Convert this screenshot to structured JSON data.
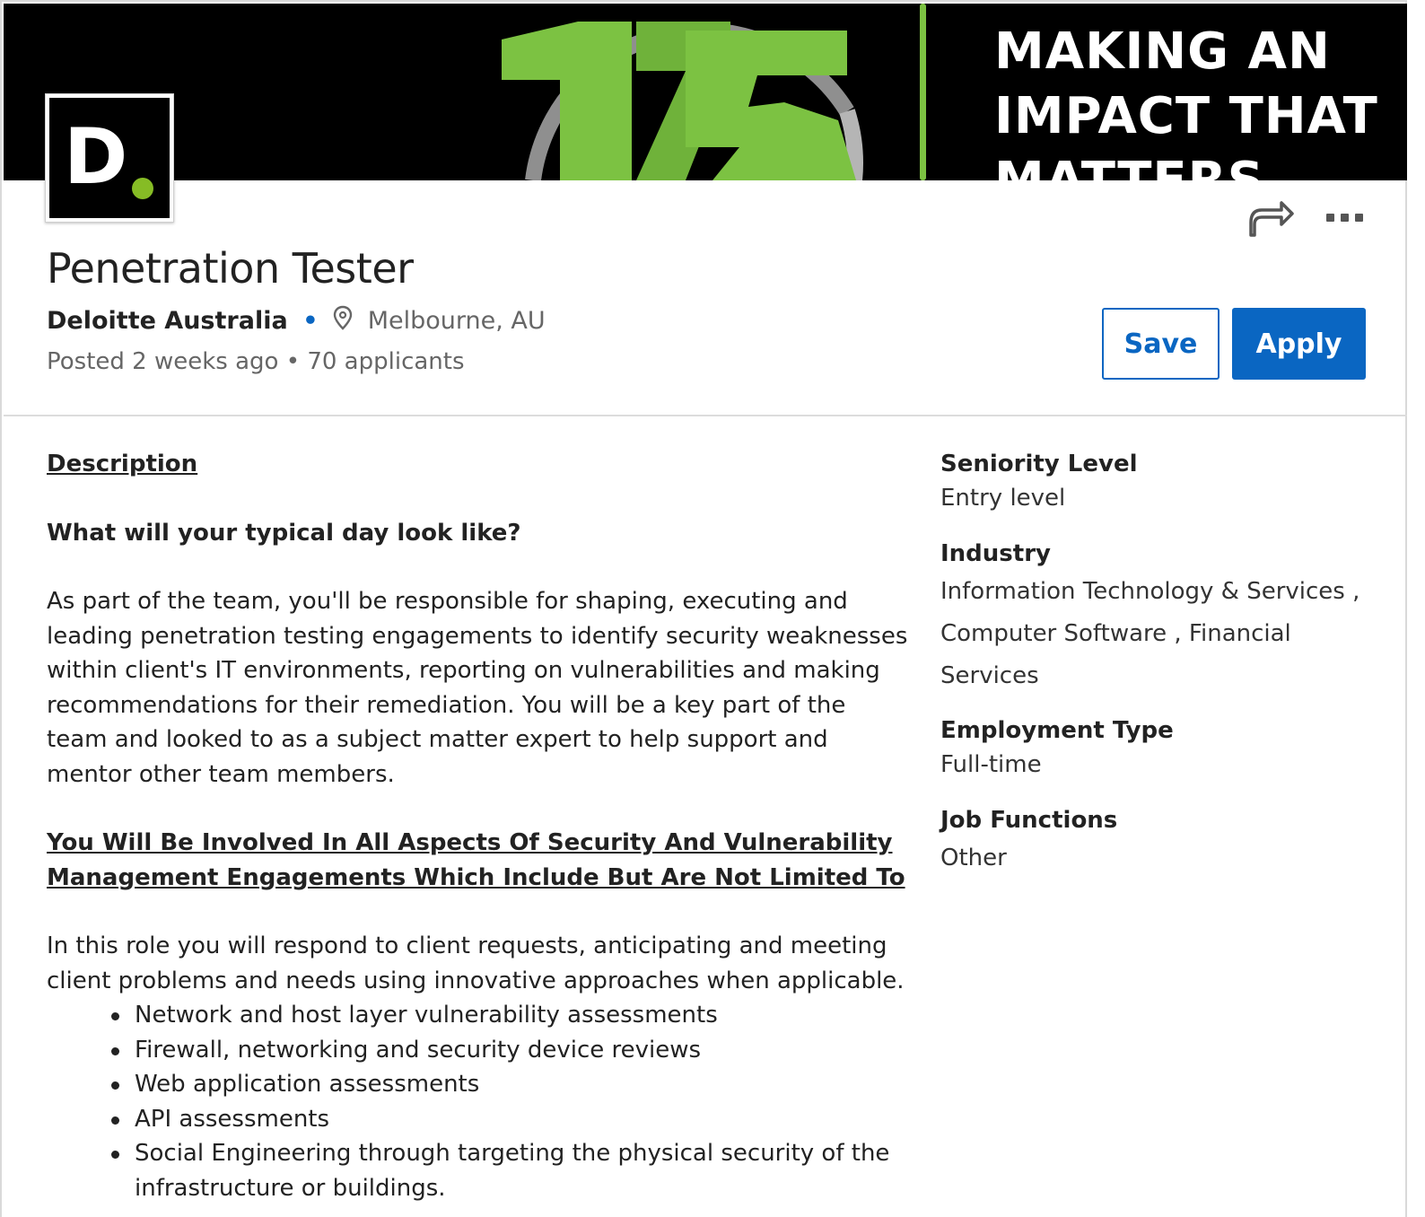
{
  "banner": {
    "number": "175",
    "lines": [
      "MAKING AN",
      "IMPACT THAT",
      "MATTERS"
    ],
    "colors": {
      "green": "#7cc242",
      "ring": "#9a9a9a",
      "background": "#000000"
    }
  },
  "logo": {
    "letter": "D",
    "dot_color": "#86bc25"
  },
  "icons": {
    "share": "share-arrow-icon",
    "more": "more-options-icon",
    "location": "location-pin-icon"
  },
  "job": {
    "title": "Penetration Tester",
    "company": "Deloitte Australia",
    "separator": "•",
    "location": "Melbourne, AU",
    "posted": "Posted 2 weeks ago",
    "applicants": "70 applicants"
  },
  "actions": {
    "save_label": "Save",
    "apply_label": "Apply",
    "accent": "#0a66c2"
  },
  "description": {
    "heading": "Description",
    "question": "What will your typical day look like?",
    "paragraph1": "As part of the team, you'll be responsible for shaping, executing and leading penetration testing engagements to identify security weaknesses within client's IT environments, reporting on vulnerabilities and making recommendations for their remediation. You will be a key part of the team and looked to as a subject matter expert to help support and mentor other team members.",
    "subheading": "You Will Be Involved In All Aspects Of Security And Vulnerability Management Engagements Which Include But Are Not Limited To",
    "paragraph2": "In this role you will respond to client requests, anticipating and meeting client problems and needs using innovative approaches when applicable.",
    "bullets": [
      "Network and host layer vulnerability assessments",
      "Firewall, networking and security device reviews",
      "Web application assessments",
      "API assessments",
      "Social Engineering through targeting the physical security of the infrastructure or buildings."
    ]
  },
  "criteria": {
    "seniority_label": "Seniority Level",
    "seniority_value": "Entry level",
    "industry_label": "Industry",
    "industry_line1": "Information Technology & Services ,",
    "industry_line2": "Computer Software , Financial Services",
    "employment_label": "Employment Type",
    "employment_value": "Full-time",
    "functions_label": "Job Functions",
    "functions_value": "Other"
  }
}
